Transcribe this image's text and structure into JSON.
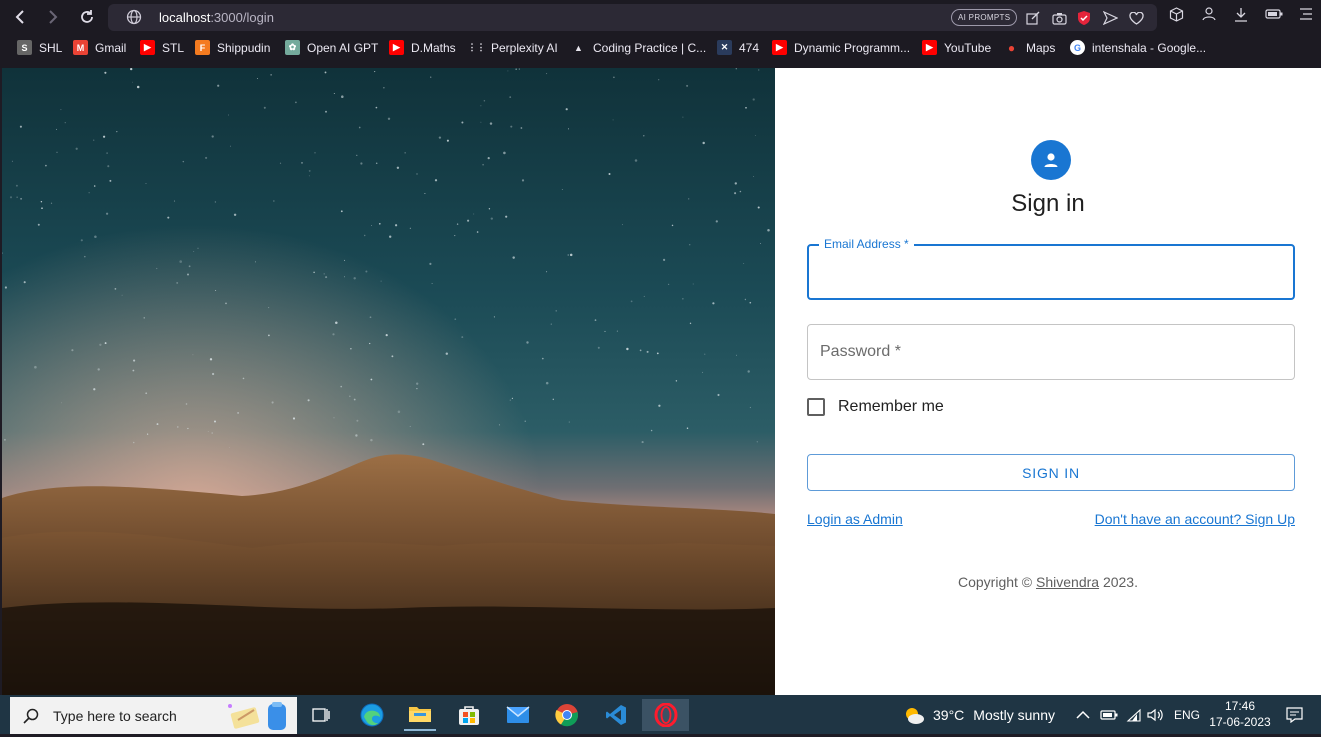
{
  "browser": {
    "url_host": "localhost",
    "url_path": ":3000/login",
    "ai_prompts_label": "AI PROMPTS",
    "bookmarks": [
      {
        "label": "SHL",
        "icon": "shl-icon",
        "color": "#666666",
        "glyph": "S"
      },
      {
        "label": "Gmail",
        "icon": "gmail-icon",
        "color": "#ea4335",
        "glyph": "M"
      },
      {
        "label": "STL",
        "icon": "youtube-icon",
        "color": "#ff0000",
        "glyph": "▶"
      },
      {
        "label": "Shippudin",
        "icon": "shippudin-icon",
        "color": "#f47b20",
        "glyph": "F"
      },
      {
        "label": "Open AI GPT",
        "icon": "openai-icon",
        "color": "#74aa9c",
        "glyph": "✿"
      },
      {
        "label": "D.Maths",
        "icon": "youtube-icon",
        "color": "#ff0000",
        "glyph": "▶"
      },
      {
        "label": "Perplexity AI",
        "icon": "apps-grid-icon",
        "color": "#1c1a22",
        "glyph": "⋮⋮"
      },
      {
        "label": "Coding Practice | C...",
        "icon": "mountain-icon",
        "color": "#1c1a22",
        "glyph": "▲"
      },
      {
        "label": "474",
        "icon": "codeforces-icon",
        "color": "#2a3b5c",
        "glyph": "✕"
      },
      {
        "label": "Dynamic Programm...",
        "icon": "youtube-icon",
        "color": "#ff0000",
        "glyph": "▶"
      },
      {
        "label": "YouTube",
        "icon": "youtube-icon",
        "color": "#ff0000",
        "glyph": "▶"
      },
      {
        "label": "Maps",
        "icon": "maps-pin-icon",
        "color": "#34a853",
        "glyph": "●"
      },
      {
        "label": "intenshala - Google...",
        "icon": "google-icon",
        "color": "#ffffff",
        "glyph": "G"
      }
    ]
  },
  "login": {
    "title": "Sign in",
    "email_label": "Email Address *",
    "email_value": "",
    "password_placeholder": "Password *",
    "remember_label": "Remember me",
    "signin_button": "SIGN IN",
    "admin_link": "Login as Admin",
    "signup_link": "Don't have an account? Sign Up",
    "copyright_prefix": "Copyright © ",
    "copyright_name": "Shivendra",
    "copyright_suffix": " 2023.",
    "accent_color": "#1976d2"
  },
  "taskbar": {
    "search_placeholder": "Type here to search",
    "weather_temp": "39°C",
    "weather_text": "Mostly sunny",
    "language": "ENG",
    "time": "17:46",
    "date": "17-06-2023"
  }
}
